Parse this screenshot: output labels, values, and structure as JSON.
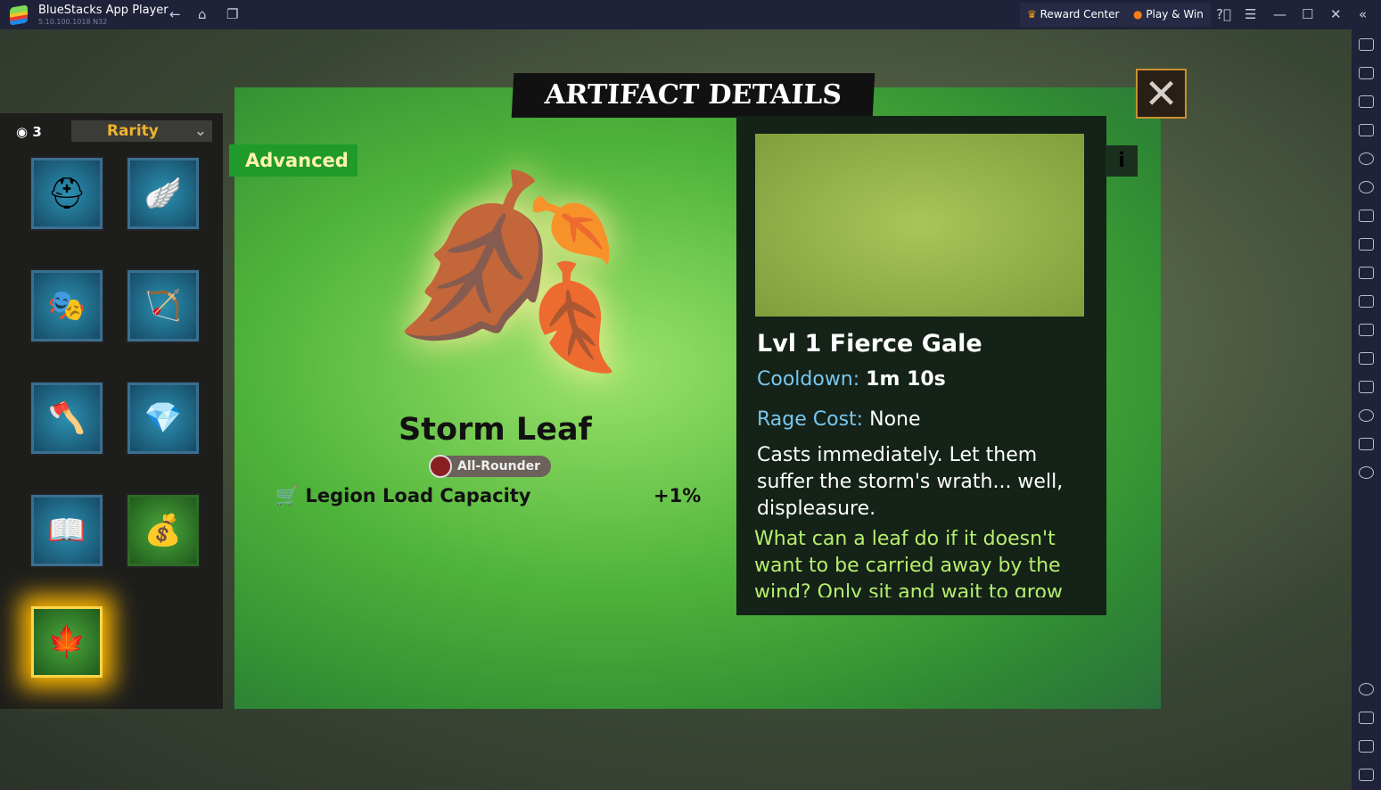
{
  "titlebar": {
    "app_name": "BlueStacks App Player",
    "version": "5.10.100.1018  N32",
    "reward_center": "Reward Center",
    "play_win": "Play & Win"
  },
  "inventory": {
    "count": "3",
    "filter": "Rarity",
    "items": [
      "helmet",
      "winged-boots",
      "mask",
      "bow",
      "axe",
      "crystal",
      "book",
      "coins",
      "storm-leaf"
    ]
  },
  "modal": {
    "title": "ARTIFACT DETAILS",
    "rarity": "Advanced",
    "artifact_name": "Storm Leaf",
    "role": "All-Rounder",
    "stat_label": "Legion Load Capacity",
    "stat_value": "+1%",
    "skill": {
      "title": "Lvl 1 Fierce Gale",
      "cooldown_label": "Cooldown:",
      "cooldown_value": "1m 10s",
      "rage_label": "Rage Cost:",
      "rage_value": "None",
      "description": "Casts immediately. Let them suffer the storm's wrath... well, displeasure.",
      "lore": "What can a leaf do if it doesn't want to be carried away by the wind? Only sit and wait to grow tall."
    },
    "info_label": "i",
    "close_label": "✕"
  },
  "colors": {
    "accent": "#1f9a2b",
    "rarity": "#f0b22c",
    "cooldown": "#79c6ef",
    "lore": "#b6ef6d"
  }
}
